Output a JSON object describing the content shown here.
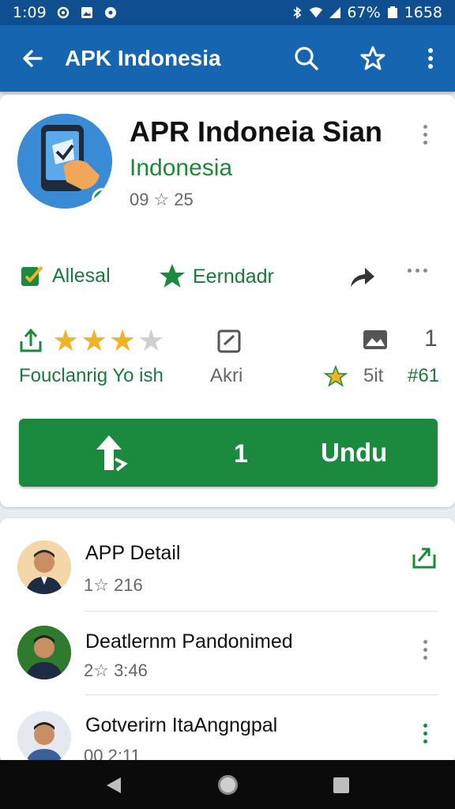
{
  "status_bar": {
    "time": "1:09",
    "battery_percent": "67%",
    "right_time": "1658",
    "icons": [
      "settings-icon",
      "photo-icon",
      "circle-icon",
      "bluetooth-icon",
      "wifi-icon",
      "signal-icon",
      "battery-icon"
    ]
  },
  "app_bar": {
    "title": "APK Indonesia",
    "icons": [
      "back-arrow-icon",
      "search-icon",
      "star-outline-icon",
      "more-vert-icon"
    ]
  },
  "app": {
    "name": "APR Indoneia Sian",
    "developer": "Indonesia",
    "meta_count": "09",
    "meta_rating": "25"
  },
  "chips": {
    "chip1": "Allesal",
    "chip2": "Eerndadr"
  },
  "rating_row": {
    "stars_filled": 3,
    "stars_total": 4,
    "label_left": "Fouclanrig Yo ish",
    "label_mid": "Akri",
    "size": "5it",
    "count": "#61",
    "right_number": "1"
  },
  "install": {
    "count": "1",
    "label": "Undu",
    "color": "#1b8a3e"
  },
  "list": [
    {
      "title": "APP Detail",
      "subtitle": "1☆ 216"
    },
    {
      "title": "Deatlernm Pandonimed",
      "subtitle": "2☆ 3:46"
    },
    {
      "title": "Gotverirn ItaAngngpal",
      "subtitle": "00 2:11"
    }
  ],
  "colors": {
    "app_bar": "#1565b0",
    "status_bar": "#0f4f8f",
    "accent_green": "#1b8a3e",
    "star": "#f0b323"
  }
}
